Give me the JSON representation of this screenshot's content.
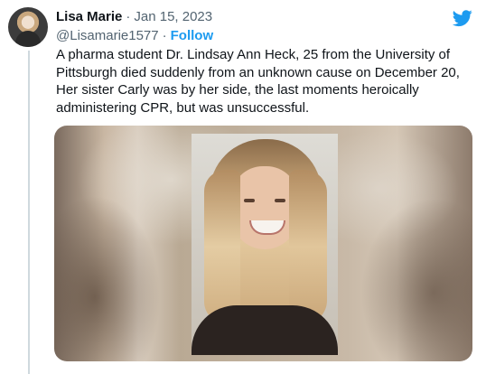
{
  "tweet": {
    "author_name": "Lisa Marie",
    "separator": "·",
    "date": "Jan 15, 2023",
    "handle": "@Lisamarie1577",
    "handle_separator": "·",
    "follow_label": "Follow",
    "text": "A pharma student Dr. Lindsay Ann Heck, 25 from the University of Pittsburgh died suddenly from an unknown cause on December 20, Her sister Carly was by her side, the last moments heroically administering CPR, but was unsuccessful.",
    "platform_icon": "twitter-bird-icon",
    "accent_color": "#1d9bf0"
  }
}
